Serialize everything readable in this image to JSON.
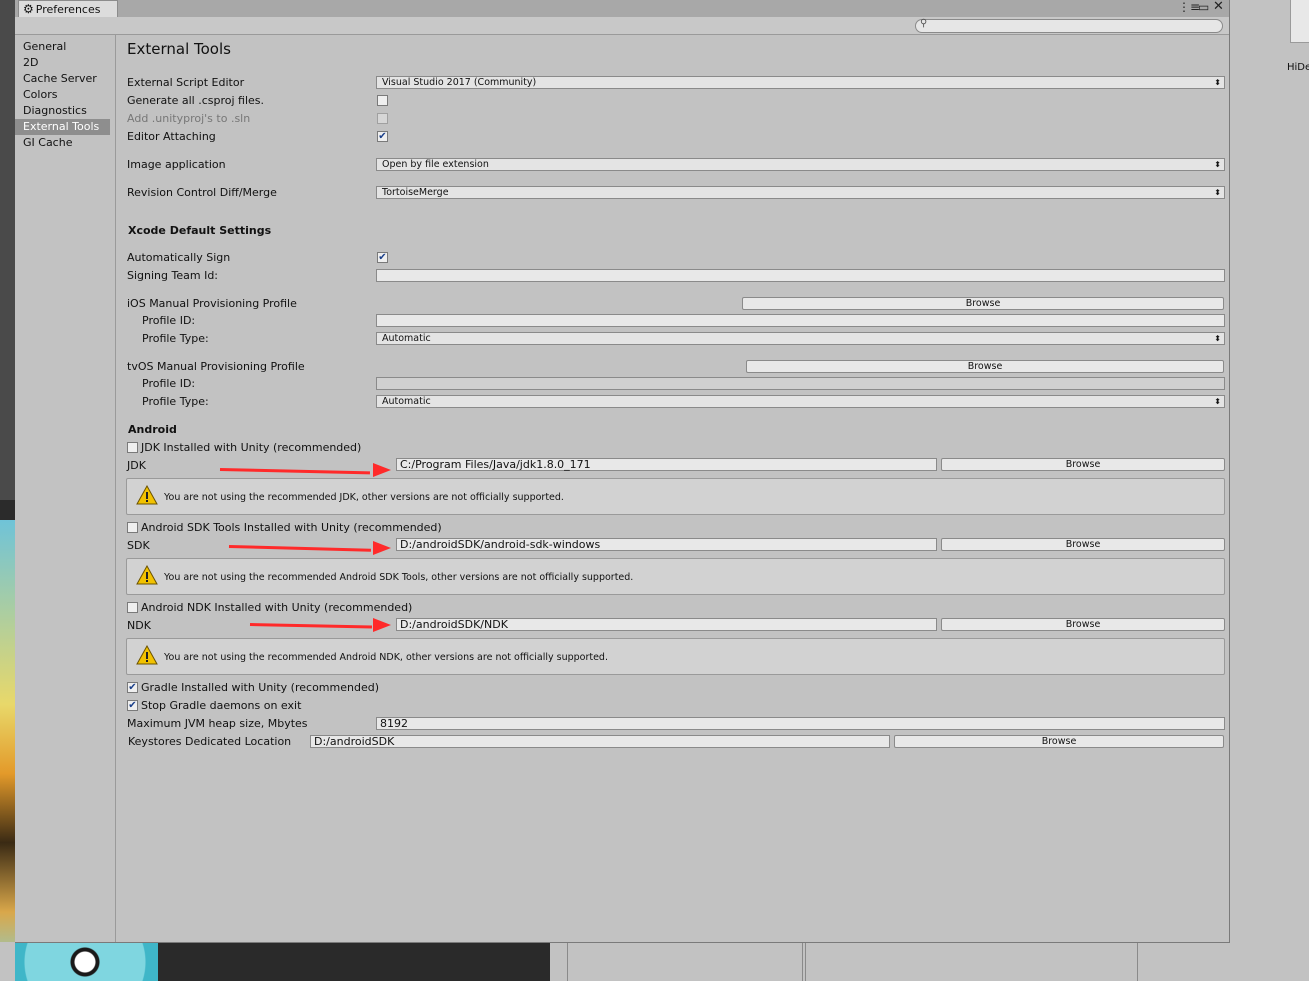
{
  "window": {
    "tab_title": "Preferences",
    "colors": {
      "accent_arrow": "#ff2a2a",
      "selected_item": "#8e8e8e",
      "window_bg": "#c2c2c2"
    }
  },
  "background": {
    "right_label": "HiDe"
  },
  "sidebar": {
    "items": [
      {
        "label": "General"
      },
      {
        "label": "2D"
      },
      {
        "label": "Cache Server"
      },
      {
        "label": "Colors"
      },
      {
        "label": "Diagnostics"
      },
      {
        "label": "External Tools",
        "selected": true
      },
      {
        "label": "GI Cache"
      }
    ]
  },
  "main": {
    "title": "External Tools",
    "external_script_editor": {
      "label": "External Script Editor",
      "value": "Visual Studio 2017 (Community)"
    },
    "generate_csproj": {
      "label": "Generate all .csproj files.",
      "checked": false
    },
    "add_unityproj": {
      "label": "Add .unityproj's to .sln",
      "checked": false,
      "disabled": true
    },
    "editor_attaching": {
      "label": "Editor Attaching",
      "checked": true
    },
    "image_application": {
      "label": "Image application",
      "value": "Open by file extension"
    },
    "revision_control": {
      "label": "Revision Control Diff/Merge",
      "value": "TortoiseMerge"
    },
    "xcode": {
      "heading": "Xcode Default Settings",
      "auto_sign": {
        "label": "Automatically Sign",
        "checked": true
      },
      "signing_team": {
        "label": "Signing Team Id:",
        "value": ""
      },
      "ios": {
        "label": "iOS Manual Provisioning Profile",
        "browse": "Browse",
        "profile_id_label": "Profile ID:",
        "profile_id": "",
        "profile_type_label": "Profile Type:",
        "profile_type": "Automatic"
      },
      "tvos": {
        "label": "tvOS Manual Provisioning Profile",
        "browse": "Browse",
        "profile_id_label": "Profile ID:",
        "profile_id": "",
        "profile_type_label": "Profile Type:",
        "profile_type": "Automatic"
      }
    },
    "android": {
      "heading": "Android",
      "jdk": {
        "toggle": "JDK Installed with Unity (recommended)",
        "checked": false,
        "label": "JDK",
        "path": "C:/Program Files/Java/jdk1.8.0_171",
        "browse": "Browse",
        "warning": "You are not using the recommended JDK, other versions are not officially supported."
      },
      "sdk": {
        "toggle": "Android SDK Tools Installed with Unity (recommended)",
        "checked": false,
        "label": "SDK",
        "path": "D:/androidSDK/android-sdk-windows",
        "browse": "Browse",
        "warning": "You are not using the recommended Android SDK Tools, other versions are not officially supported."
      },
      "ndk": {
        "toggle": "Android NDK Installed with Unity (recommended)",
        "checked": false,
        "label": "NDK",
        "path": "D:/androidSDK/NDK",
        "browse": "Browse",
        "warning": "You are not using the recommended Android NDK, other versions are not officially supported."
      },
      "gradle": {
        "label": "Gradle Installed with Unity (recommended)",
        "checked": true
      },
      "stop_gradle": {
        "label": "Stop Gradle daemons on exit",
        "checked": true
      },
      "jvm_heap": {
        "label": "Maximum JVM heap size, Mbytes",
        "value": "8192"
      },
      "keystores": {
        "label": "Keystores Dedicated Location",
        "value": "D:/androidSDK",
        "browse": "Browse"
      }
    }
  }
}
